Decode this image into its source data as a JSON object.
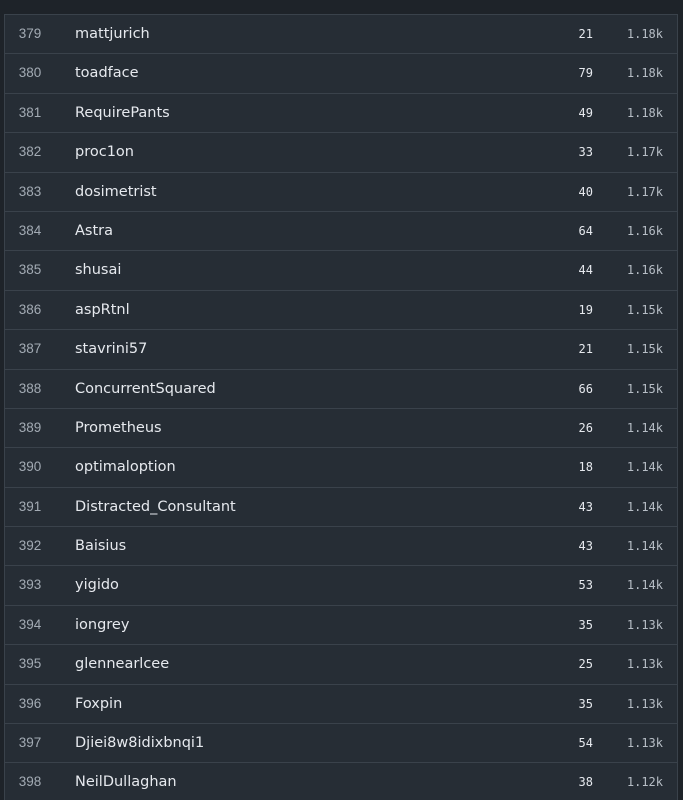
{
  "leaderboard": {
    "rows": [
      {
        "rank": "379",
        "username": "mattjurich",
        "count": "21",
        "score": "1.18k"
      },
      {
        "rank": "380",
        "username": "toadface",
        "count": "79",
        "score": "1.18k"
      },
      {
        "rank": "381",
        "username": "RequirePants",
        "count": "49",
        "score": "1.18k"
      },
      {
        "rank": "382",
        "username": "proc1on",
        "count": "33",
        "score": "1.17k"
      },
      {
        "rank": "383",
        "username": "dosimetrist",
        "count": "40",
        "score": "1.17k"
      },
      {
        "rank": "384",
        "username": "Astra",
        "count": "64",
        "score": "1.16k"
      },
      {
        "rank": "385",
        "username": "shusai",
        "count": "44",
        "score": "1.16k"
      },
      {
        "rank": "386",
        "username": "aspRtnl",
        "count": "19",
        "score": "1.15k"
      },
      {
        "rank": "387",
        "username": "stavrini57",
        "count": "21",
        "score": "1.15k"
      },
      {
        "rank": "388",
        "username": "ConcurrentSquared",
        "count": "66",
        "score": "1.15k"
      },
      {
        "rank": "389",
        "username": "Prometheus",
        "count": "26",
        "score": "1.14k"
      },
      {
        "rank": "390",
        "username": "optimaloption",
        "count": "18",
        "score": "1.14k"
      },
      {
        "rank": "391",
        "username": "Distracted_Consultant",
        "count": "43",
        "score": "1.14k"
      },
      {
        "rank": "392",
        "username": "Baisius",
        "count": "43",
        "score": "1.14k"
      },
      {
        "rank": "393",
        "username": "yigido",
        "count": "53",
        "score": "1.14k"
      },
      {
        "rank": "394",
        "username": "iongrey",
        "count": "35",
        "score": "1.13k"
      },
      {
        "rank": "395",
        "username": "glennearlcee",
        "count": "25",
        "score": "1.13k"
      },
      {
        "rank": "396",
        "username": "Foxpin",
        "count": "35",
        "score": "1.13k"
      },
      {
        "rank": "397",
        "username": "Djiei8w8idixbnqi1",
        "count": "54",
        "score": "1.13k"
      },
      {
        "rank": "398",
        "username": "NeilDullaghan",
        "count": "38",
        "score": "1.12k"
      }
    ]
  },
  "colors": {
    "page_background": "#1e2329",
    "row_background": "#262d35",
    "row_border": "#3a424b",
    "rank_text": "#a3abb4",
    "username_text": "#e6e9ee",
    "score_text": "#b7bec6"
  }
}
